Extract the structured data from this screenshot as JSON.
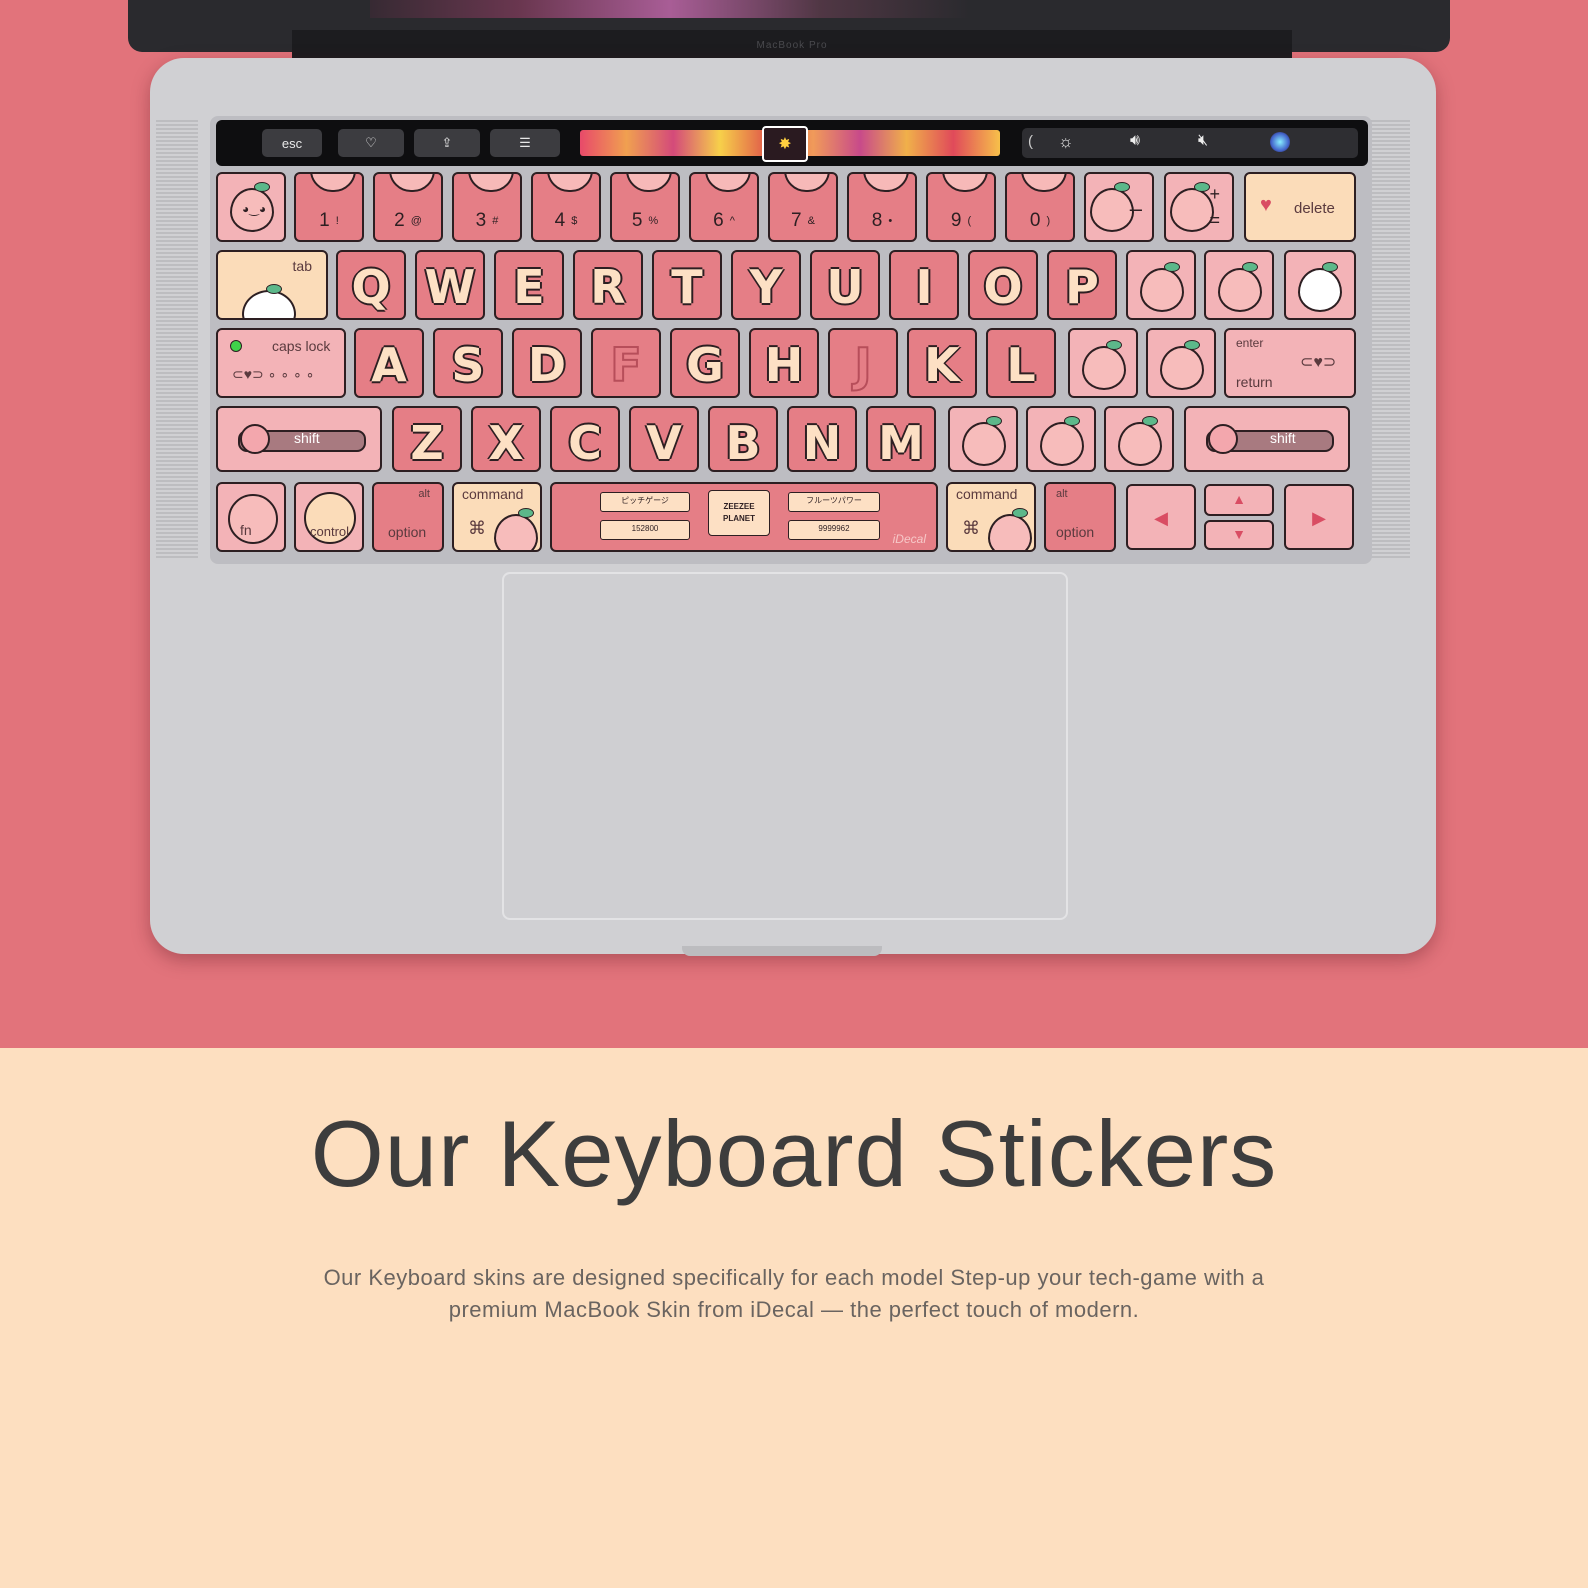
{
  "touchbar": {
    "esc_label": "esc",
    "heart_icon": "heart-icon",
    "share_icon": "share-icon",
    "sliders_icon": "sliders-icon",
    "brightness_icon": "brightness-icon",
    "volume_icon": "volume-icon",
    "mute_icon": "mute-icon",
    "siri_icon": "siri-icon",
    "chevron": "("
  },
  "keyboard": {
    "number_row": [
      {
        "num": "1",
        "sym": "!"
      },
      {
        "num": "2",
        "sym": "@"
      },
      {
        "num": "3",
        "sym": "#"
      },
      {
        "num": "4",
        "sym": "$"
      },
      {
        "num": "5",
        "sym": "%"
      },
      {
        "num": "6",
        "sym": "^"
      },
      {
        "num": "7",
        "sym": "&"
      },
      {
        "num": "8",
        "sym": "•"
      },
      {
        "num": "9",
        "sym": "("
      },
      {
        "num": "0",
        "sym": ")"
      }
    ],
    "minus_label": "–",
    "plus_label": "+",
    "equals_label": "=",
    "delete_label": "delete",
    "tab_label": "tab",
    "row_q": [
      "Q",
      "W",
      "E",
      "R",
      "T",
      "Y",
      "U",
      "I",
      "O",
      "P"
    ],
    "caps_label": "caps lock",
    "row_a": [
      "A",
      "S",
      "D",
      "F",
      "G",
      "H",
      "J",
      "K",
      "L"
    ],
    "enter_label": "enter",
    "return_label": "return",
    "shift_label": "shift",
    "row_z": [
      "Z",
      "X",
      "C",
      "V",
      "B",
      "N",
      "M"
    ],
    "fn_label": "fn",
    "control_label": "control",
    "alt_label": "alt",
    "option_label": "option",
    "command_label": "command",
    "cmd_symbol": "⌘",
    "space_left_panel": "ピッチゲージ",
    "space_left_value": "152800",
    "space_center_line1": "ZEEZEE",
    "space_center_line2": "PLANET",
    "space_right_panel": "フルーツパワー",
    "space_right_value": "9999962",
    "space_brand": "iDecal",
    "arrow_left": "◀",
    "arrow_up": "▲",
    "arrow_down": "▼",
    "arrow_right": "▶"
  },
  "laptop": {
    "hinge_label": "MacBook Pro"
  },
  "heading": "Our Keyboard Stickers",
  "description_line1": "Our Keyboard skins are designed specifically for each model Step-up your tech-game with a",
  "description_line2": "premium MacBook Skin from iDecal — the perfect touch of modern.",
  "colors": {
    "hero_background": "#e2737b",
    "lower_background": "#fddfc0",
    "key_pink": "#e57e86",
    "key_light": "#f3b3b7",
    "key_cream": "#fbdcb9",
    "text_dark": "#3d3d3d"
  }
}
